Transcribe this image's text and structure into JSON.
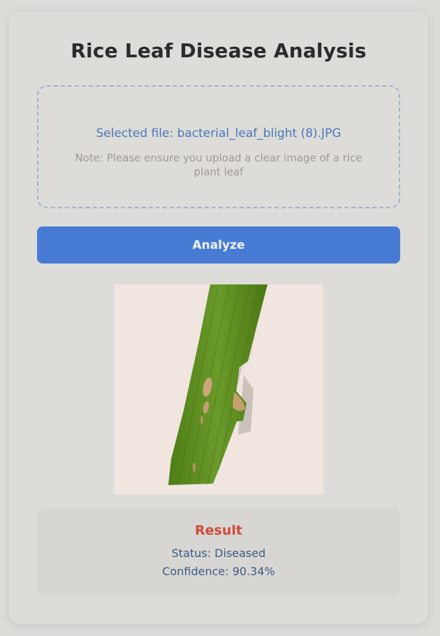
{
  "page": {
    "title": "Rice Leaf Disease Analysis"
  },
  "upload": {
    "selected_file": "Selected file: bacterial_leaf_blight (8).JPG",
    "note": "Note: Please ensure you upload a clear image of a rice plant leaf"
  },
  "actions": {
    "analyze_label": "Analyze"
  },
  "preview": {
    "alt": "bacterial_leaf_blight (8).JPG",
    "background_color": "#f0e6df",
    "leaf_color": "#5c8a1f",
    "lesion_color": "#c9a77a"
  },
  "result": {
    "title": "Result",
    "status": "Status: Diseased",
    "confidence": "Confidence: 90.34%"
  },
  "colors": {
    "accent": "#487cd4",
    "result_title": "#d24a3a",
    "result_text": "#3d5a86",
    "file_text": "#4a78b8"
  }
}
